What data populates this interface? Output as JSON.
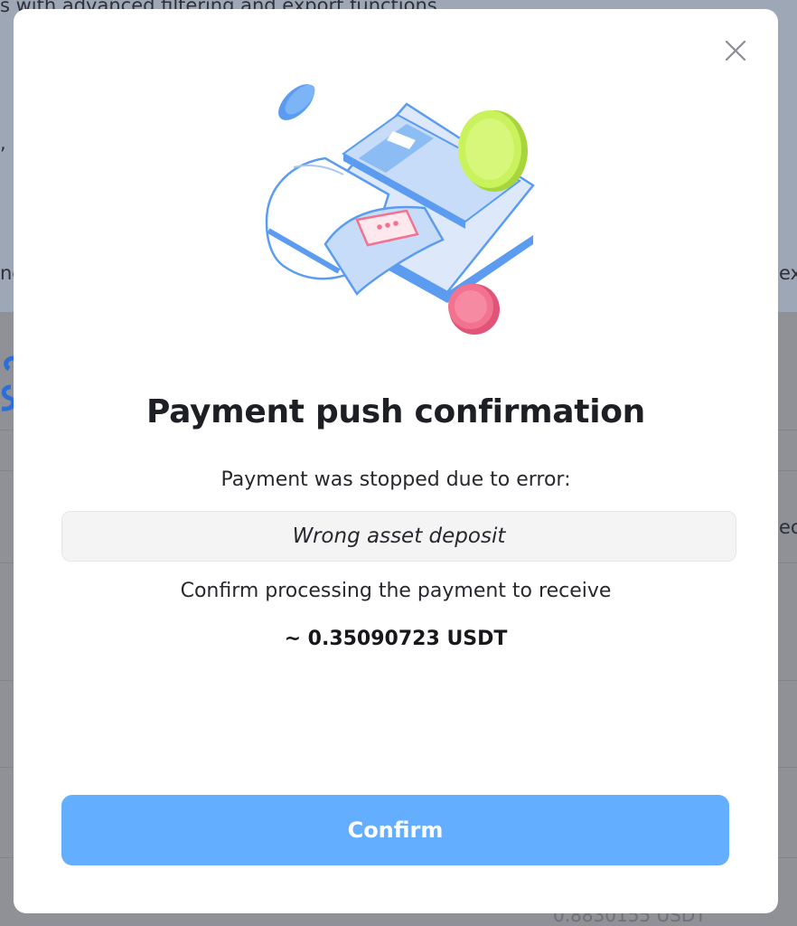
{
  "background_page": {
    "snippet_top": "s with advanced filtering and export functions",
    "snippet_comma": ",",
    "snippet_left": "ne",
    "snippet_right": "ex",
    "snippet_right2": "ec",
    "snippet_bottom_value": "0.8830155 USDT"
  },
  "modal": {
    "title": "Payment push confirmation",
    "subtitle": "Payment was stopped due to error:",
    "error_message": "Wrong asset deposit",
    "confirm_prompt": "Confirm processing the payment to receive",
    "amount": "~ 0.35090723 USDT",
    "confirm_button_label": "Confirm",
    "close_icon": "close-icon",
    "illustration_icon": "payment-terminal-illustration"
  },
  "colors": {
    "accent": "#64aeff",
    "overlay": "#8f9196",
    "coin_green": "#c9f25c",
    "coin_pink": "#f2728f",
    "coin_blue": "#5b9cf0"
  }
}
